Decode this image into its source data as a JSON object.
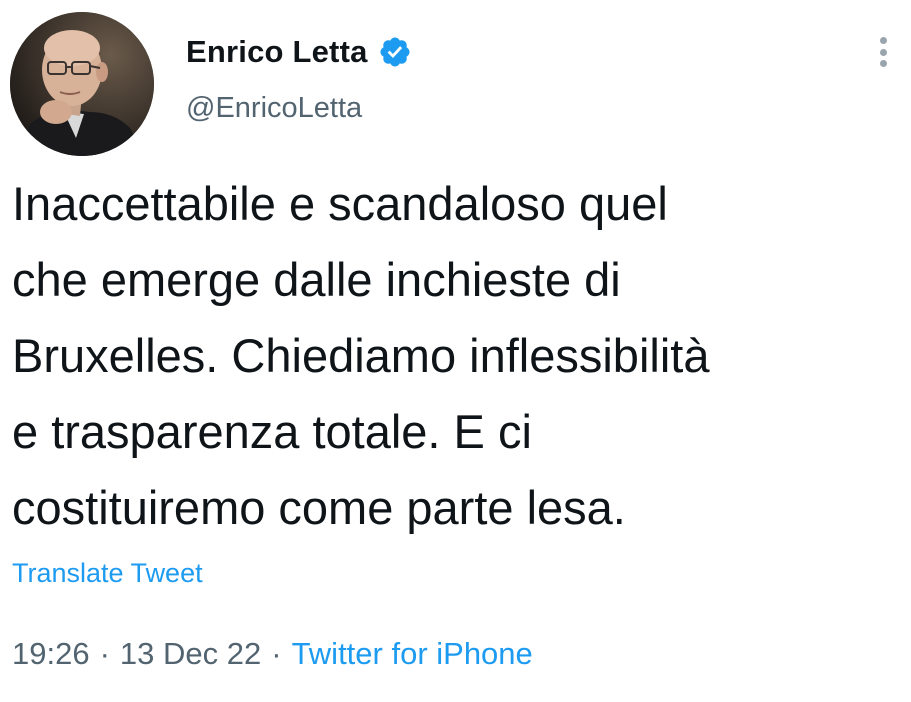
{
  "author": {
    "display_name": "Enrico Letta",
    "handle": "@EnricoLetta",
    "verified": true,
    "avatar_icon": "profile-photo",
    "verified_icon": "verified-badge-icon"
  },
  "header": {
    "more_icon": "more-vertical-icon"
  },
  "tweet": {
    "lines": [
      "Inaccettabile e scandaloso quel",
      "che emerge dalle inchieste di",
      "Bruxelles. Chiediamo inflessibilità",
      "e trasparenza totale. E ci",
      "costituiremo come parte lesa."
    ],
    "translate_label": "Translate Tweet"
  },
  "meta": {
    "time": "19:26",
    "separator": "·",
    "date": "13 Dec 22",
    "source": "Twitter for iPhone"
  },
  "colors": {
    "accent": "#1d9bf0",
    "text": "#0f1419",
    "secondary": "#536471"
  }
}
